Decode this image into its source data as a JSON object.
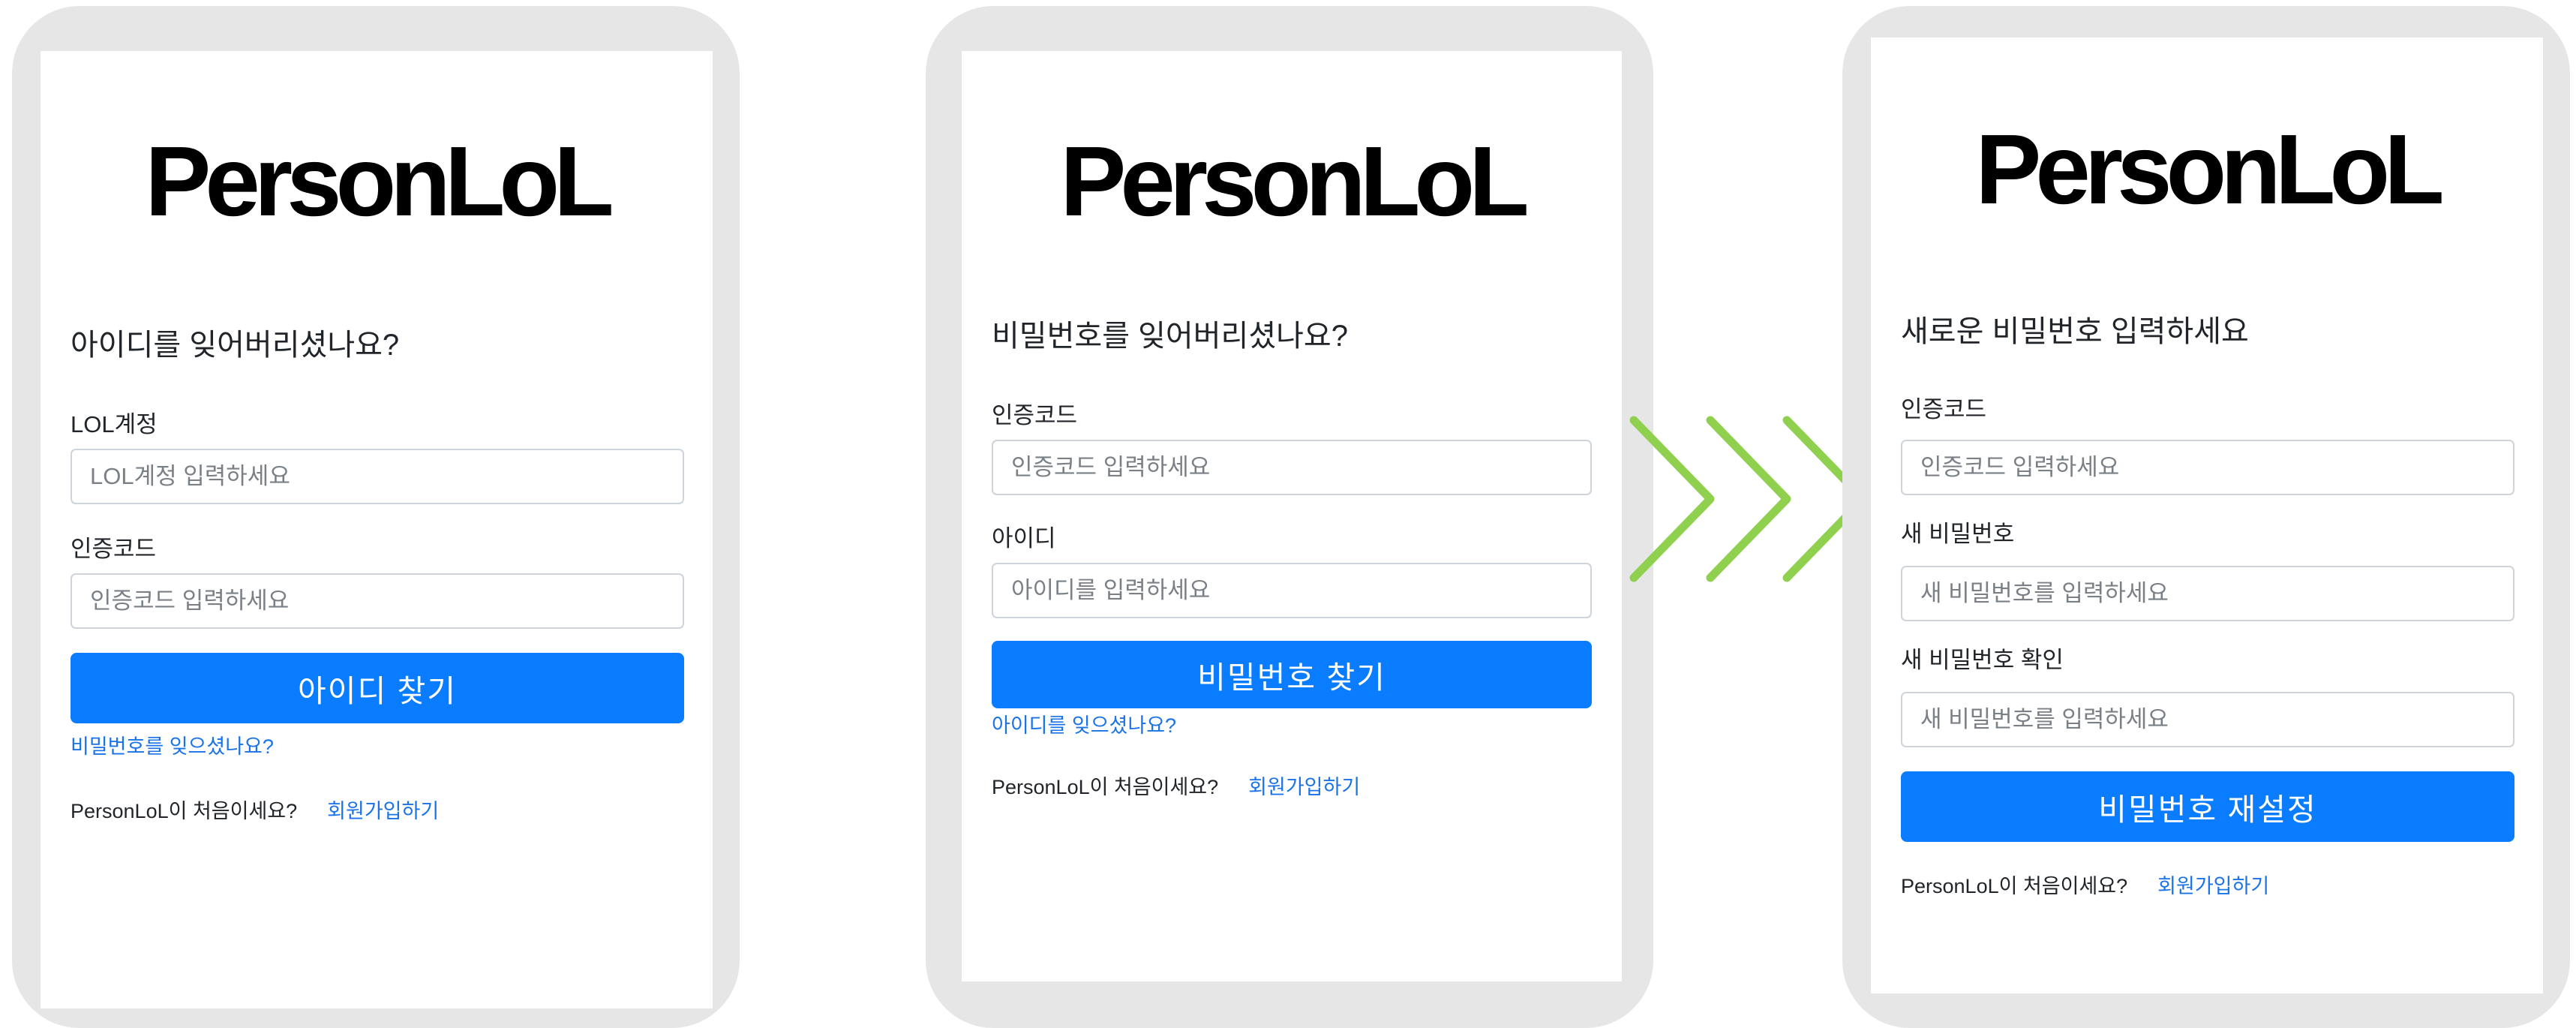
{
  "brand": "PersonLoL",
  "colors": {
    "primary_button": "#0a7cff",
    "link": "#1a73e8",
    "frame": "#e6e6e6",
    "chevron": "#8fd14f"
  },
  "panel_find_id": {
    "title": "아이디를 잊어버리셨나요?",
    "account_label": "LOL계정",
    "account_placeholder": "LOL계정 입력하세요",
    "code_label": "인증코드",
    "code_placeholder": "인증코드 입력하세요",
    "submit_label": "아이디 찾기",
    "forgot_password_link": "비밀번호를 잊으셨나요?",
    "new_user_text": "PersonLoL이 처음이세요?",
    "signup_link": "회원가입하기"
  },
  "panel_find_password": {
    "title": "비밀번호를 잊어버리셨나요?",
    "code_label": "인증코드",
    "code_placeholder": "인증코드 입력하세요",
    "id_label": "아이디",
    "id_placeholder": "아이디를 입력하세요",
    "submit_label": "비밀번호 찾기",
    "forgot_id_link": "아이디를 잊으셨나요?",
    "new_user_text": "PersonLoL이 처음이세요?",
    "signup_link": "회원가입하기"
  },
  "transition_arrow_icon": "triple-chevron-right-icon",
  "panel_reset_password": {
    "title": "새로운 비밀번호 입력하세요",
    "code_label": "인증코드",
    "code_placeholder": "인증코드 입력하세요",
    "new_password_label": "새 비밀번호",
    "new_password_placeholder": "새 비밀번호를 입력하세요",
    "confirm_label": "새 비밀번호 확인",
    "confirm_placeholder": "새 비밀번호를 입력하세요",
    "submit_label": "비밀번호 재설정",
    "new_user_text": "PersonLoL이 처음이세요?",
    "signup_link": "회원가입하기"
  }
}
